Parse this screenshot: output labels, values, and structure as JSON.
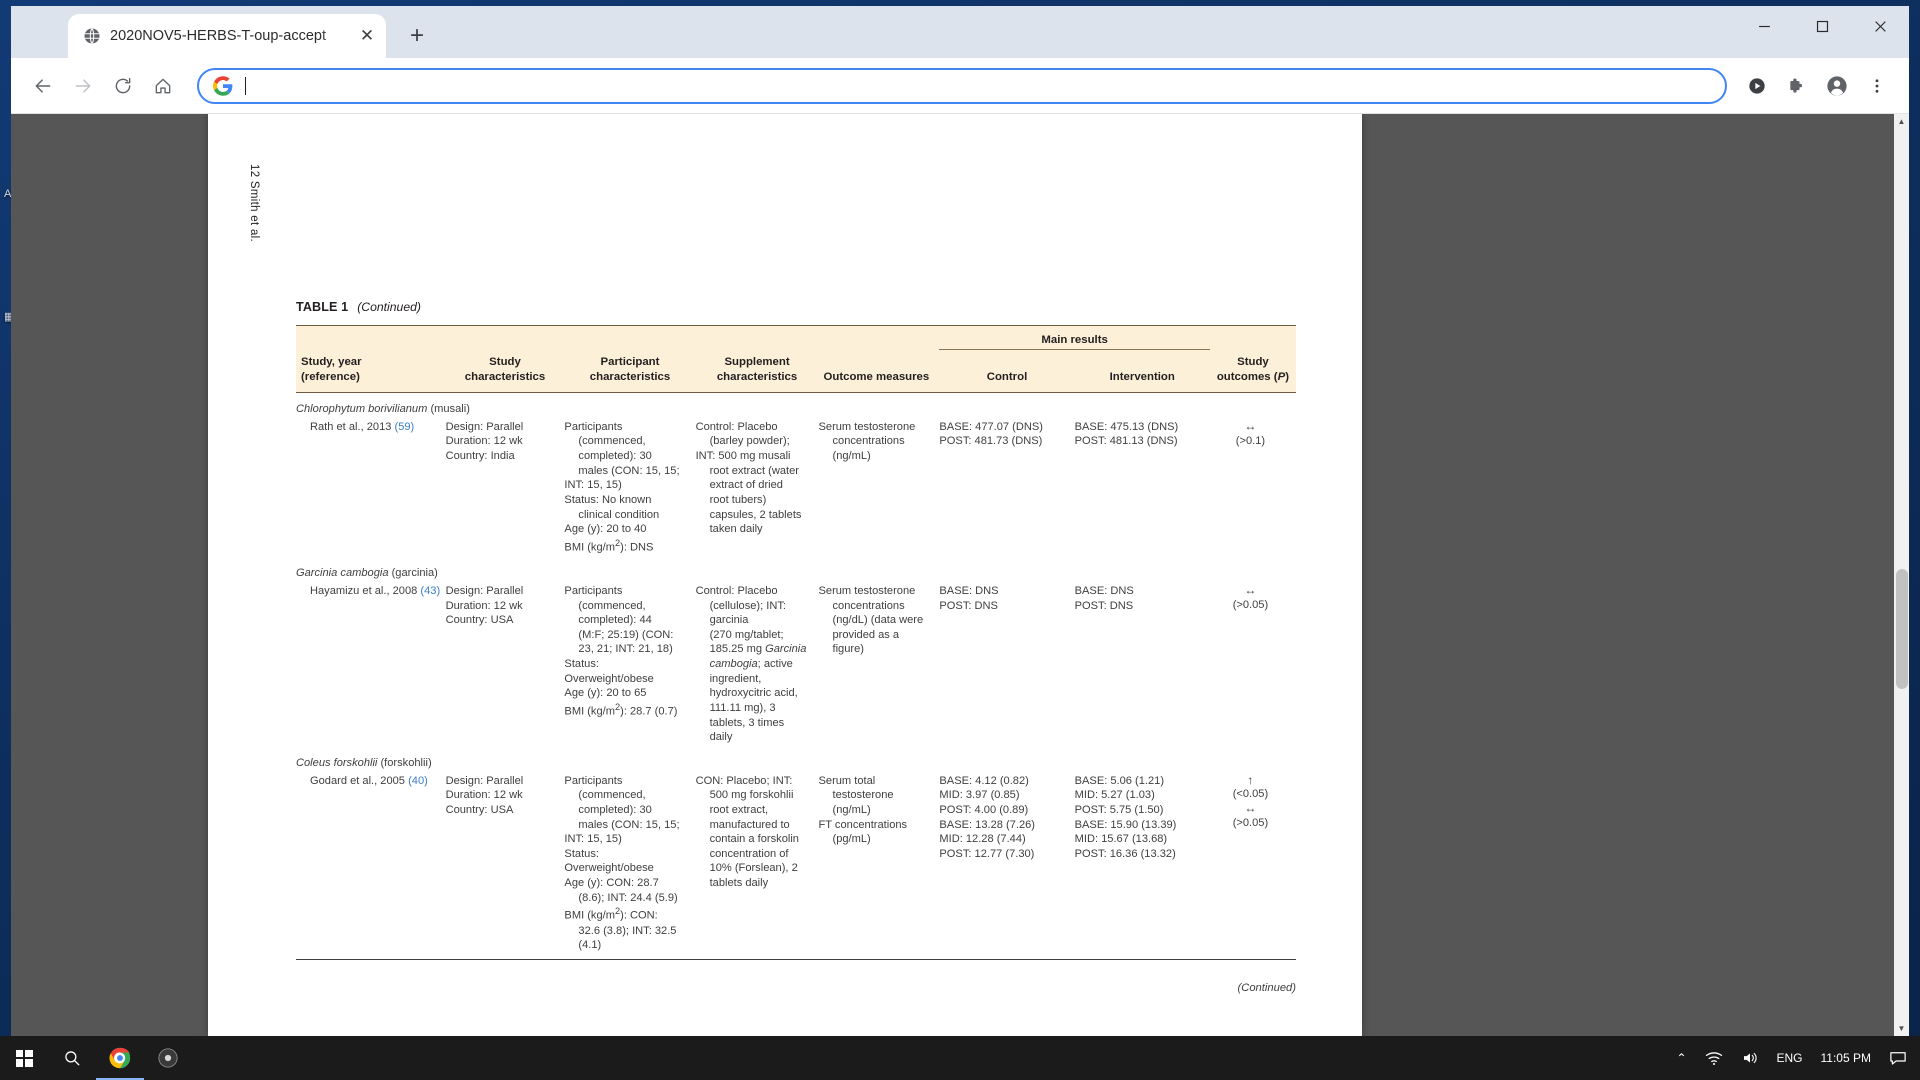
{
  "browser": {
    "tab": {
      "title": "2020NOV5-HERBS-T-oup-accept",
      "favicon": "globe-icon",
      "close": "✕"
    },
    "new_tab": "+",
    "window_controls": {
      "minimize": "—",
      "maximize": "□",
      "close": "✕"
    },
    "toolbar": {
      "back": "←",
      "forward": "→",
      "reload": "⟳",
      "home": "⌂",
      "address_value": "",
      "address_placeholder": "",
      "search_engine_icon": "google-g-icon",
      "media_button": "▶",
      "extensions": "puzzle-piece-icon",
      "profile": "person-icon",
      "menu": "⋮"
    }
  },
  "document": {
    "running_head": "12     Smith et al.",
    "caption_label": "TABLE 1",
    "caption_continued": "(Continued)",
    "footer_continued": "(Continued)",
    "headers": {
      "col1_line1": "Study, year",
      "col1_line2": "(reference)",
      "col2_line1": "Study",
      "col2_line2": "characteristics",
      "col3_line1": "Participant",
      "col3_line2": "characteristics",
      "col4_line1": "Supplement",
      "col4_line2": "characteristics",
      "col5": "Outcome measures",
      "group_main_results": "Main results",
      "col6": "Control",
      "col7": "Intervention",
      "col8_line1": "Study",
      "col8_line2_pre": "outcomes (",
      "col8_line2_ital": "P",
      "col8_line2_post": ")"
    },
    "rows": [
      {
        "species_italic": "Chlorophytum borivilianum",
        "species_common": "(musali)",
        "study": "Rath et al., 2013",
        "ref": "(59)",
        "study_characteristics": [
          "Design: Parallel",
          "Duration: 12 wk",
          "Country: India"
        ],
        "participant_characteristics": [
          "Participants",
          "(commenced,",
          "completed): 30",
          "males (CON: 15, 15;",
          "INT: 15, 15)",
          "Status: No known",
          "clinical condition",
          "Age (y): 20 to 40",
          "BMI (kg/m2): DNS"
        ],
        "supplement_characteristics": [
          "Control: Placebo",
          "(barley powder);",
          "INT: 500 mg musali",
          "root extract (water",
          "extract of dried",
          "root tubers)",
          "capsules, 2 tablets",
          "taken daily"
        ],
        "outcome_measures": [
          "Serum testosterone",
          "concentrations",
          "(ng/mL)"
        ],
        "control": [
          "BASE: 477.07 (DNS)",
          "POST: 481.73 (DNS)"
        ],
        "intervention": [
          "BASE: 475.13 (DNS)",
          "POST: 481.13 (DNS)"
        ],
        "outcomes": [
          {
            "arrow": "↔",
            "p": "(>0.1)"
          }
        ]
      },
      {
        "species_italic": "Garcinia cambogia",
        "species_common": "(garcinia)",
        "study": "Hayamizu et al., 2008",
        "ref": "(43)",
        "study_characteristics": [
          "Design: Parallel",
          "Duration: 12 wk",
          "Country: USA"
        ],
        "participant_characteristics": [
          "Participants",
          "(commenced,",
          "completed): 44",
          "(M:F; 25:19) (CON:",
          "23, 21; INT: 21, 18)",
          "Status:",
          "Overweight/obese",
          "Age (y): 20 to 65",
          "BMI (kg/m2): 28.7 (0.7)"
        ],
        "supplement_characteristics": [
          "Control: Placebo",
          "(cellulose); INT:",
          "garcinia",
          "(270 mg/tablet;",
          "185.25 mg Garcinia",
          "cambogia; active",
          "ingredient,",
          "hydroxycitric acid,",
          "111.11 mg), 3",
          "tablets, 3 times",
          "daily"
        ],
        "outcome_measures": [
          "Serum testosterone",
          "concentrations",
          "(ng/dL) (data were",
          "provided as a",
          "figure)"
        ],
        "control": [
          "BASE: DNS",
          "POST: DNS"
        ],
        "intervention": [
          "BASE: DNS",
          "POST: DNS"
        ],
        "outcomes": [
          {
            "arrow": "↔",
            "p": "(>0.05)"
          }
        ]
      },
      {
        "species_italic": "Coleus forskohlii",
        "species_common": "(forskohlii)",
        "study": "Godard et al., 2005",
        "ref": "(40)",
        "study_characteristics": [
          "Design: Parallel",
          "Duration: 12 wk",
          "Country: USA"
        ],
        "participant_characteristics": [
          "Participants",
          "(commenced,",
          "completed): 30",
          "males (CON: 15, 15;",
          "INT: 15, 15)",
          "Status:",
          "Overweight/obese",
          "Age (y): CON: 28.7",
          "(8.6); INT: 24.4 (5.9)",
          "BMI (kg/m2): CON:",
          "32.6 (3.8); INT: 32.5",
          "(4.1)"
        ],
        "supplement_characteristics": [
          "CON: Placebo; INT:",
          "500 mg forskohlii",
          "root extract,",
          "manufactured to",
          "contain a forskolin",
          "concentration of",
          "10% (Forslean), 2",
          "tablets daily"
        ],
        "outcome_measures": [
          "Serum total",
          "testosterone",
          "(ng/mL)",
          "FT concentrations",
          "(pg/mL)"
        ],
        "control": [
          "BASE: 4.12 (0.82)",
          "MID: 3.97 (0.85)",
          "POST: 4.00 (0.89)",
          "BASE: 13.28 (7.26)",
          "MID: 12.28 (7.44)",
          "POST: 12.77 (7.30)"
        ],
        "intervention": [
          "BASE: 5.06 (1.21)",
          "MID: 5.27 (1.03)",
          "POST: 5.75 (1.50)",
          "BASE: 15.90 (13.39)",
          "MID: 15.67 (13.68)",
          "POST: 16.36 (13.32)"
        ],
        "outcomes": [
          {
            "arrow": "↑",
            "p": "(<0.05)"
          },
          {
            "arrow": "↔",
            "p": "(>0.05)"
          }
        ]
      }
    ]
  },
  "taskbar": {
    "start": "windows-logo-icon",
    "search": "search-icon",
    "chrome": "chrome-icon",
    "app": "app-icon",
    "tray_up": "⌃",
    "network": "wifi-icon",
    "volume": "speaker-icon",
    "language": "ENG",
    "time": "11:05 PM",
    "notifications": "notification-icon"
  },
  "colors": {
    "header_bg": "#fcf1d8",
    "rule": "#6f5b3e",
    "link": "#3b7fc4",
    "omnibox_border": "#4285f4",
    "taskbar_bg": "#1b1b1b"
  }
}
